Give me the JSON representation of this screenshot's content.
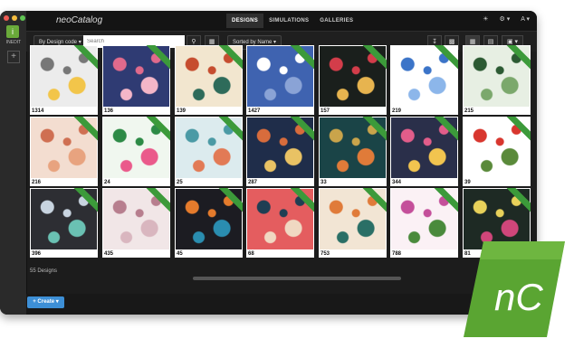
{
  "app": {
    "name": "neoCatalog",
    "label": "INEDIT"
  },
  "nav": [
    "DESIGNS",
    "SIMULATIONS",
    "GALLERIES"
  ],
  "top_right": [
    "☀",
    "⚙ ▾",
    "A ▾"
  ],
  "toolbar": {
    "filter": "By Design code ▾",
    "search_placeholder": "Search",
    "sort": "Sorted by Name ▾"
  },
  "designs": [
    "1314",
    "136",
    "139",
    "1427",
    "157",
    "219",
    "215",
    "216",
    "24",
    "25",
    "287",
    "33",
    "344",
    "39",
    "396",
    "435",
    "45",
    "68",
    "753",
    "788",
    "81"
  ],
  "design_count": "55 Designs",
  "create_label": "+ Create ▾",
  "logo_text": "nC",
  "colors": {
    "accent": "#3c9a3a",
    "create": "#3d8fd6",
    "logo": "#5aa532"
  }
}
